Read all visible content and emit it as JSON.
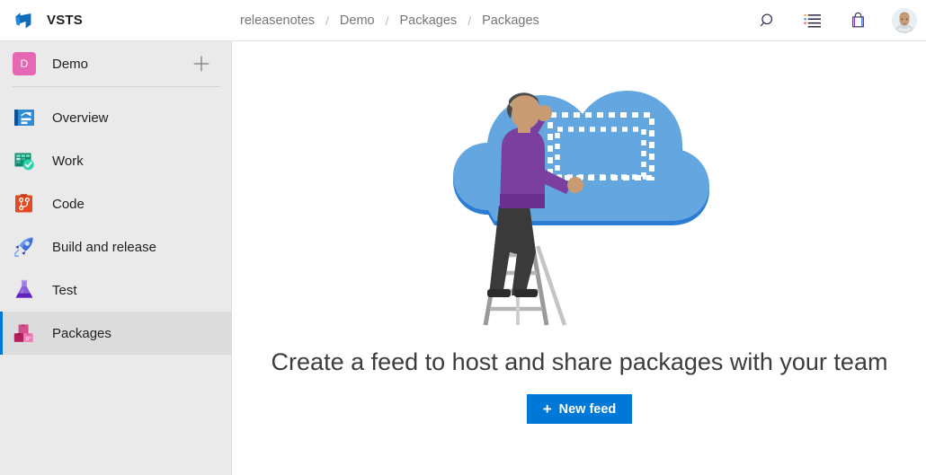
{
  "topbar": {
    "logo_icon": "vsts-logo-icon",
    "brand": "VSTS",
    "breadcrumb": [
      {
        "label": "releasenotes"
      },
      {
        "label": "Demo"
      },
      {
        "label": "Packages"
      },
      {
        "label": "Packages"
      }
    ],
    "separator": "/",
    "actions": [
      {
        "name": "search-icon",
        "label": "Search"
      },
      {
        "name": "work-items-icon",
        "label": "Work items"
      },
      {
        "name": "marketplace-bag-icon",
        "label": "Marketplace"
      },
      {
        "name": "user-avatar",
        "label": "User profile"
      }
    ]
  },
  "sidebar": {
    "project": {
      "initial": "D",
      "name": "Demo",
      "avatar_color": "#e667b3",
      "add_icon": "plus-icon"
    },
    "items": [
      {
        "label": "Overview",
        "icon": "overview-icon",
        "selected": false
      },
      {
        "label": "Work",
        "icon": "work-icon",
        "selected": false
      },
      {
        "label": "Code",
        "icon": "code-icon",
        "selected": false
      },
      {
        "label": "Build and release",
        "icon": "rocket-icon",
        "selected": false
      },
      {
        "label": "Test",
        "icon": "flask-icon",
        "selected": false
      },
      {
        "label": "Packages",
        "icon": "packages-icon",
        "selected": true
      }
    ],
    "background": "#eaeaea",
    "selected_background": "#dcdcdc",
    "accent": "#0078d7"
  },
  "main": {
    "illustration": "cloud-person-ladder-illustration",
    "heading": "Create a feed to host and share packages with your team",
    "primary_button": {
      "label": "New feed",
      "plus": "+",
      "color": "#0078d7"
    }
  }
}
